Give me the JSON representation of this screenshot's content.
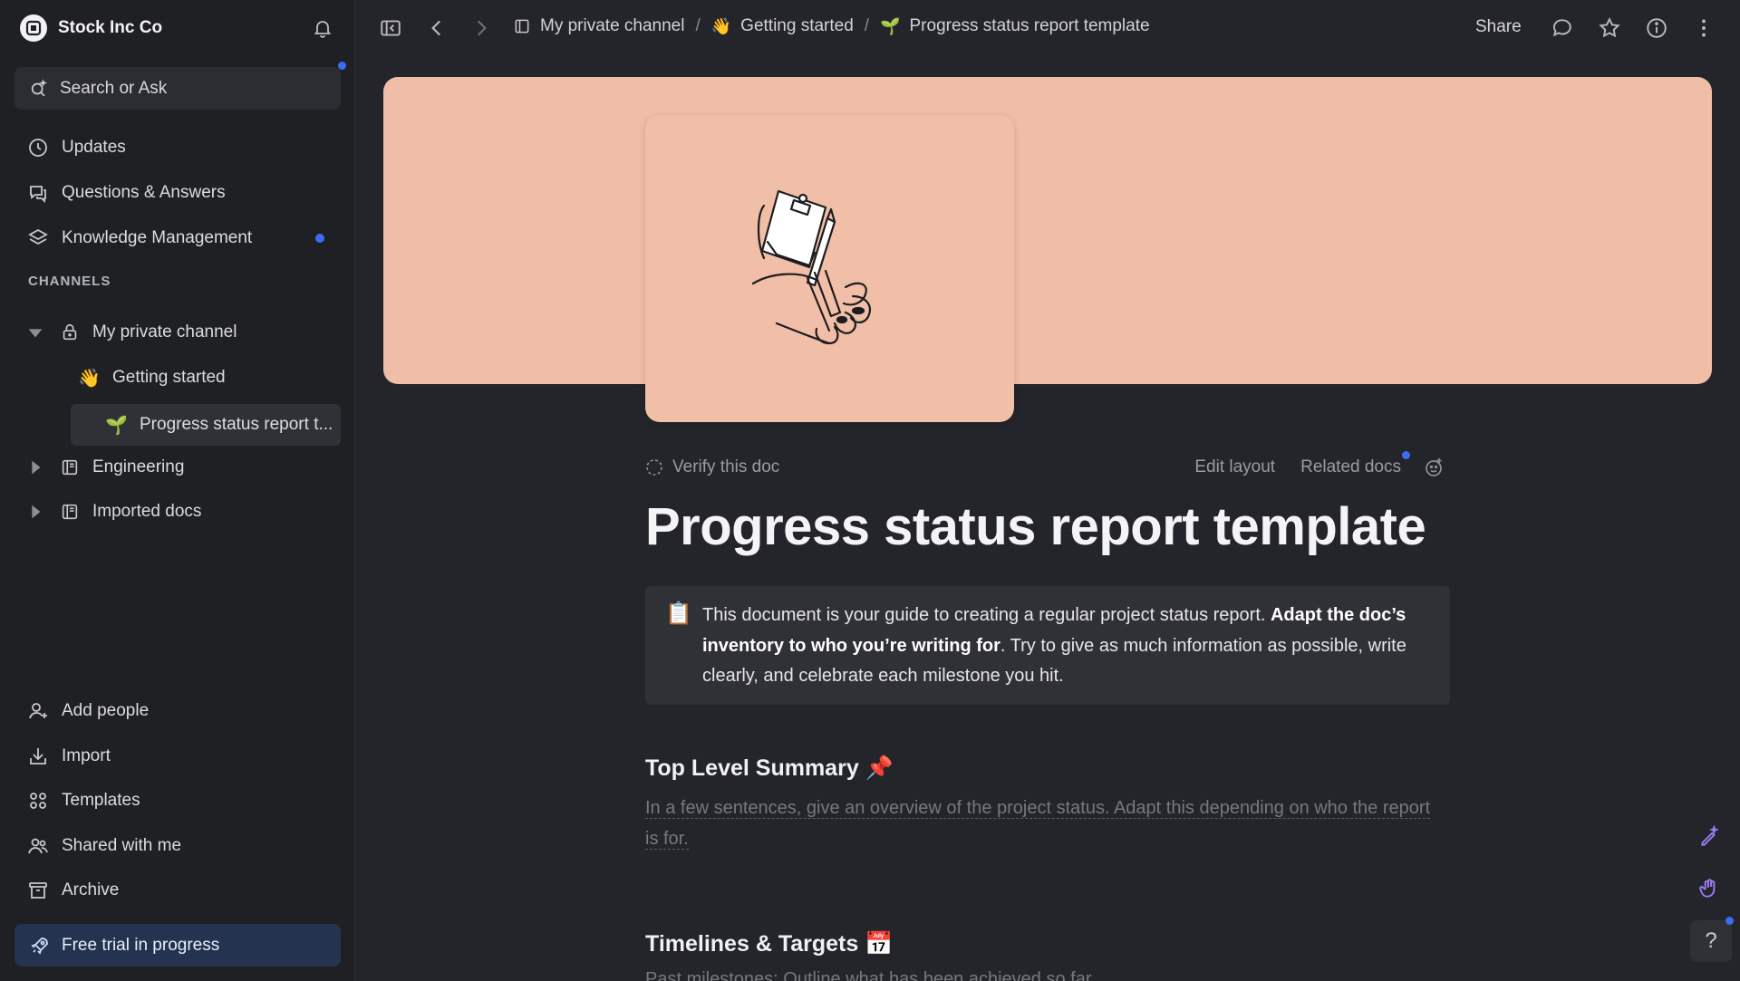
{
  "workspace": {
    "name": "Stock Inc Co"
  },
  "search": {
    "placeholder": "Search or Ask"
  },
  "nav": {
    "updates": "Updates",
    "qa": "Questions & Answers",
    "km": "Knowledge Management"
  },
  "channels": {
    "header": "CHANNELS",
    "private": "My private channel",
    "getting_started": "Getting started",
    "progress": "Progress status report t...",
    "engineering": "Engineering",
    "imported": "Imported docs"
  },
  "bottom_nav": {
    "add_people": "Add people",
    "import": "Import",
    "templates": "Templates",
    "shared": "Shared with me",
    "archive": "Archive",
    "trial": "Free trial in progress"
  },
  "breadcrumb": {
    "channel": "My private channel",
    "parent": "Getting started",
    "current": "Progress status report template"
  },
  "topbar": {
    "share": "Share"
  },
  "doc": {
    "verify": "Verify this doc",
    "edit_layout": "Edit layout",
    "related_docs": "Related docs",
    "title": "Progress status report template",
    "callout": {
      "emoji": "📋",
      "part1": "This document is your guide to creating a regular project status report. ",
      "bold": "Adapt the doc’s inventory to who you’re writing for",
      "part2": ". Try to give as much information as possible, write clearly, and celebrate each milestone you hit."
    },
    "section1": {
      "title": "Top Level Summary 📌",
      "placeholder": "In a few sentences, give an overview of the project status. Adapt this depending on who the report is for."
    },
    "section2": {
      "title": "Timelines & Targets 📅",
      "placeholder": "Past milestones: Outline what has been achieved so far."
    }
  },
  "icons": {
    "logo": "workspace-logo-icon",
    "bell": "bell-icon",
    "search": "search-sparkle-icon",
    "help": "?"
  },
  "colors": {
    "accent": "#3b6cf6",
    "cover": "#f0bea7",
    "sidebar_bg": "#1f2024",
    "main_bg": "#24252a"
  }
}
